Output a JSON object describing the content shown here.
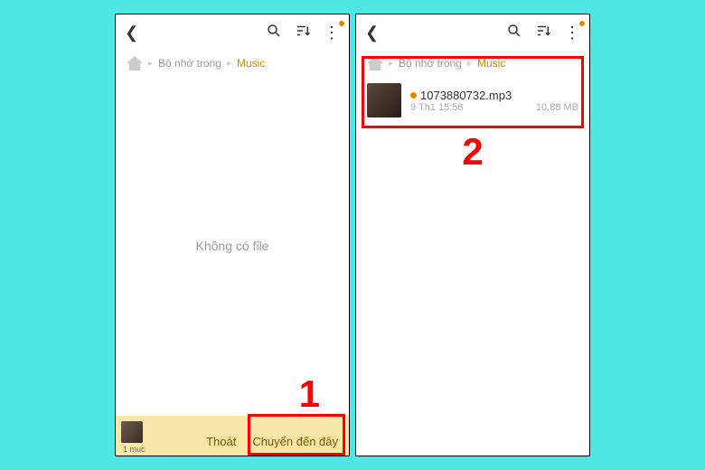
{
  "breadcrumb": {
    "storage": "Bộ nhớ trong",
    "current": "Music"
  },
  "left": {
    "empty_text": "Không có file",
    "count_label": "1 muc",
    "exit_label": "Thoát",
    "move_label": "Chuyển đến đây",
    "step": "1"
  },
  "right": {
    "file": {
      "name": "1073880732.mp3",
      "date": "9 Th1 15:56",
      "size": "10,88 MB"
    },
    "step": "2"
  }
}
